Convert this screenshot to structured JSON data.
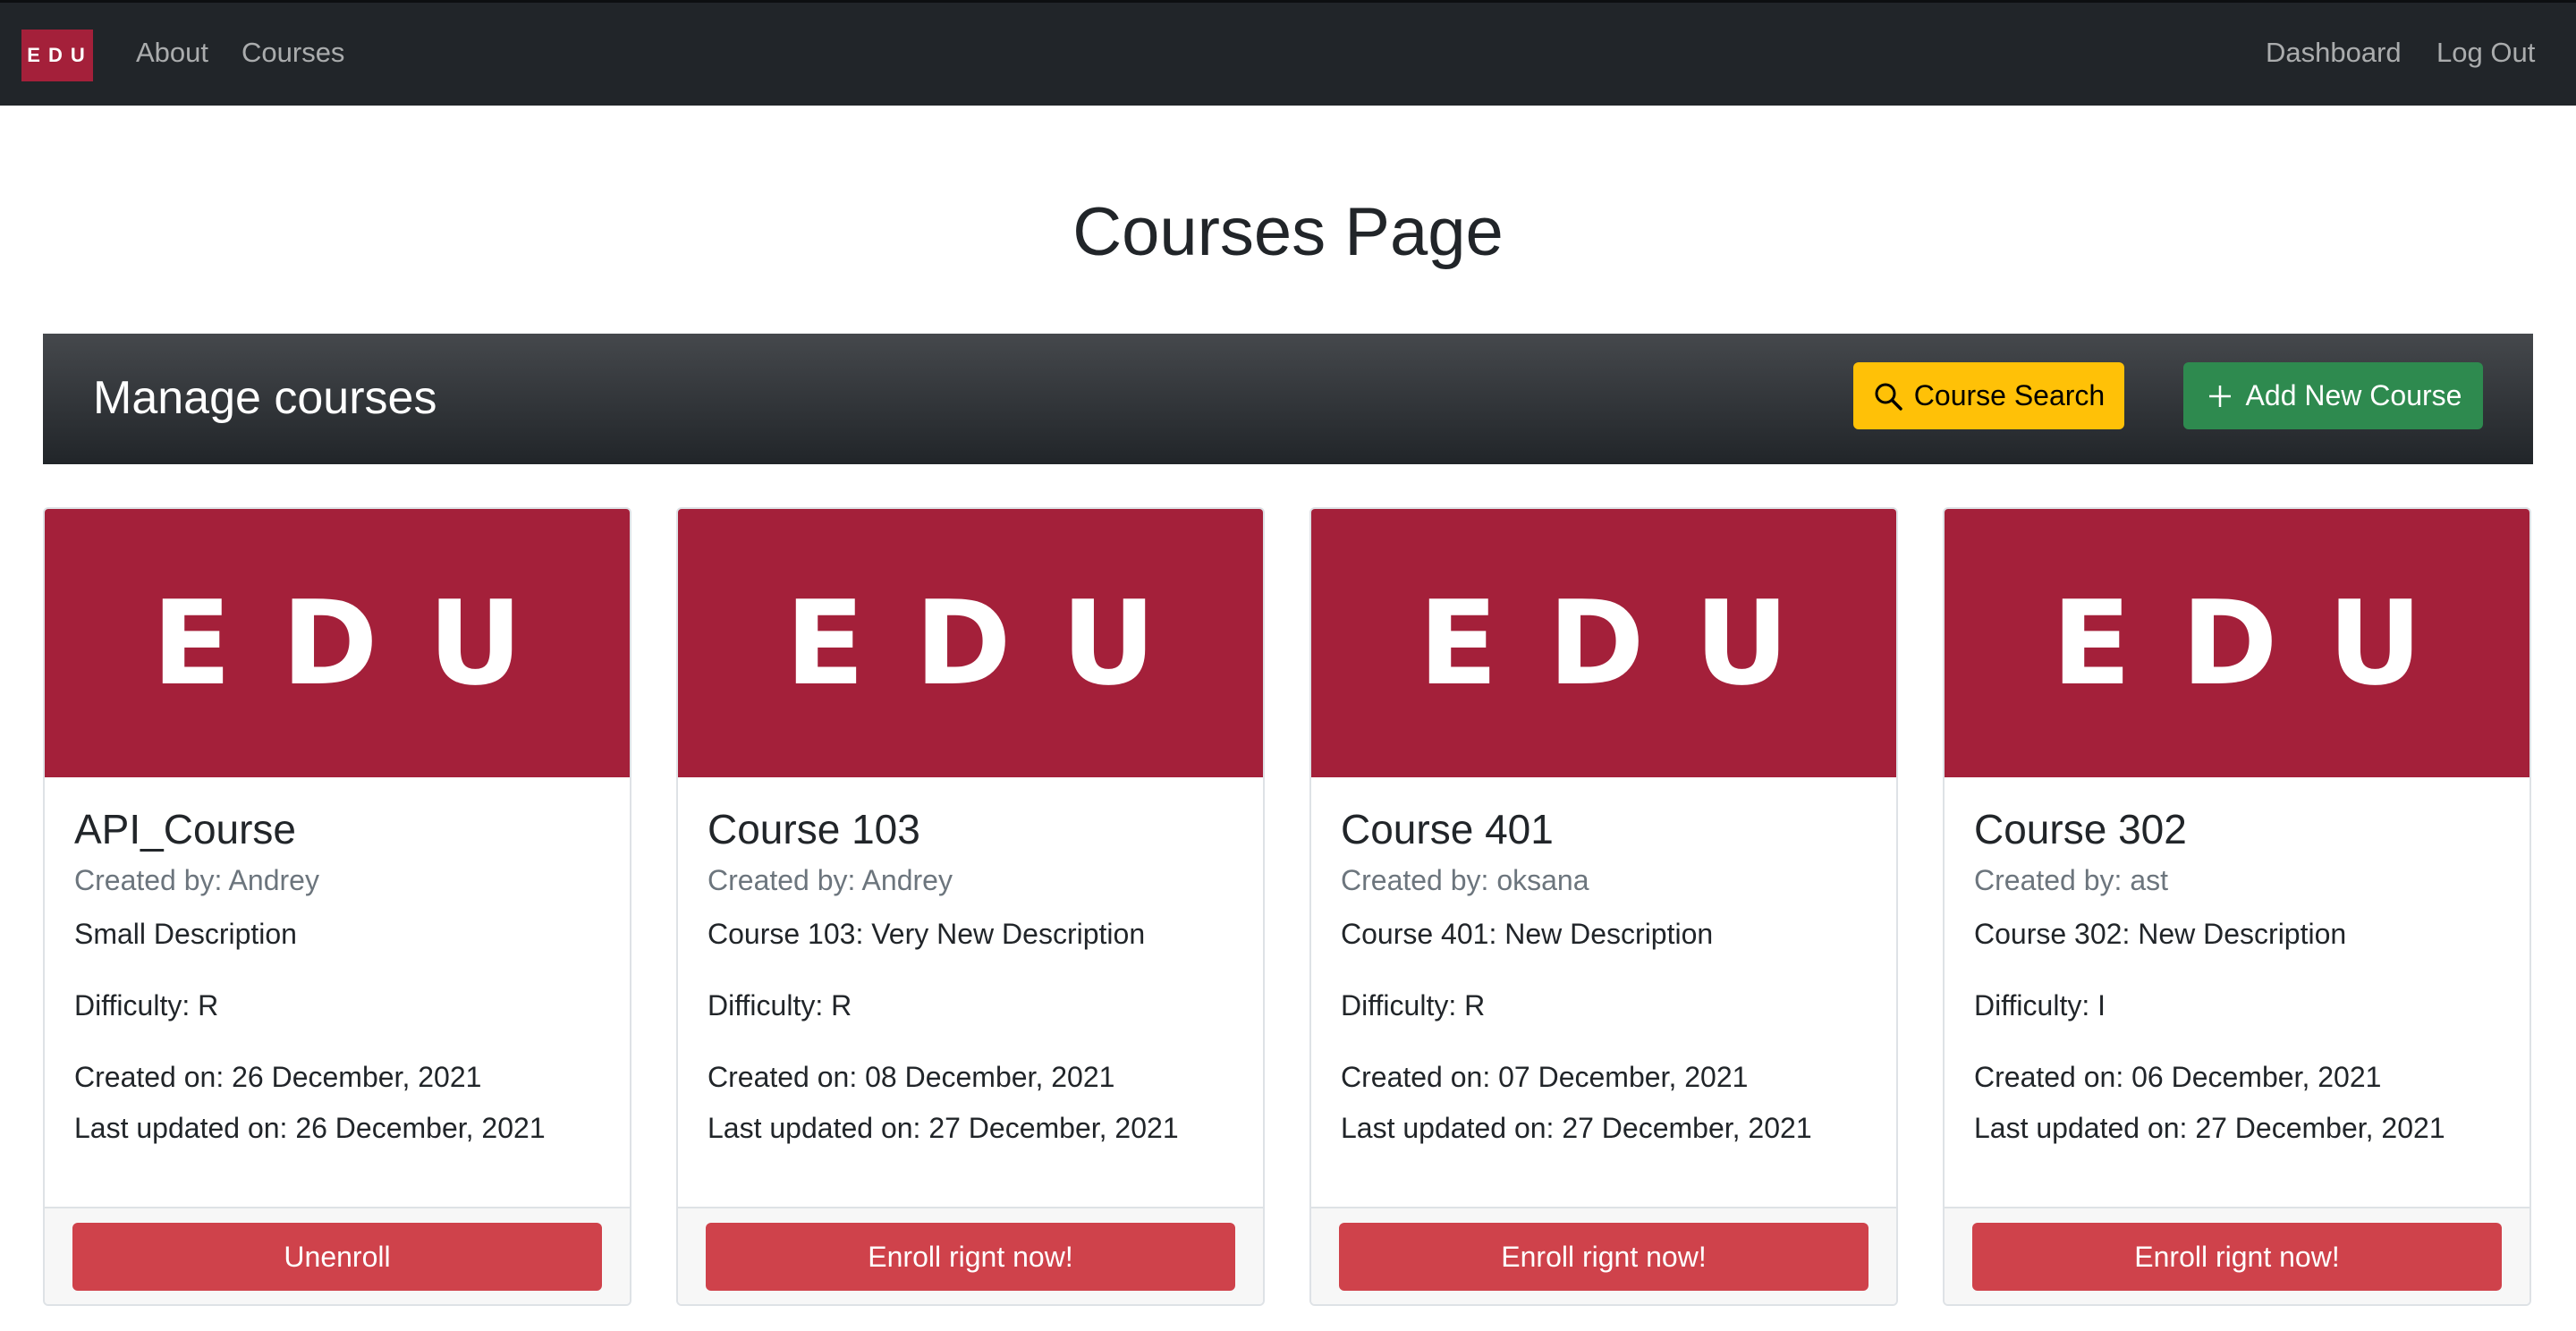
{
  "navbar": {
    "brand": "EDU",
    "links": [
      "About",
      "Courses"
    ],
    "right_links": [
      "Dashboard",
      "Log Out"
    ]
  },
  "page_title": "Courses Page",
  "manage": {
    "title": "Manage courses",
    "search_label": "Course Search",
    "add_label": "Add New Course"
  },
  "courses": [
    {
      "image_text": "EDU",
      "title": "API_Course",
      "author": "Created by: Andrey",
      "description": "Small Description",
      "difficulty": "Difficulty: R",
      "created": "Created on: 26 December, 2021",
      "updated": "Last updated on: 26 December, 2021",
      "action": "Unenroll"
    },
    {
      "image_text": "EDU",
      "title": "Course 103",
      "author": "Created by: Andrey",
      "description": "Course 103: Very New Description",
      "difficulty": "Difficulty: R",
      "created": "Created on: 08 December, 2021",
      "updated": "Last updated on: 27 December, 2021",
      "action": "Enroll rignt now!"
    },
    {
      "image_text": "EDU",
      "title": "Course 401",
      "author": "Created by: oksana",
      "description": "Course 401: New Description",
      "difficulty": "Difficulty: R",
      "created": "Created on: 07 December, 2021",
      "updated": "Last updated on: 27 December, 2021",
      "action": "Enroll rignt now!"
    },
    {
      "image_text": "EDU",
      "title": "Course 302",
      "author": "Created by: ast",
      "description": "Course 302: New Description",
      "difficulty": "Difficulty: I",
      "created": "Created on: 06 December, 2021",
      "updated": "Last updated on: 27 December, 2021",
      "action": "Enroll rignt now!"
    }
  ],
  "colors": {
    "navbar_bg": "#212529",
    "brand_red": "#a4203a",
    "search_yellow": "#ffc107",
    "add_green": "#2e8a4f",
    "card_button_red": "#cf424b",
    "subtitle_gray": "#6c757d"
  },
  "icons": {
    "search": "search-icon",
    "add": "plus-icon"
  }
}
